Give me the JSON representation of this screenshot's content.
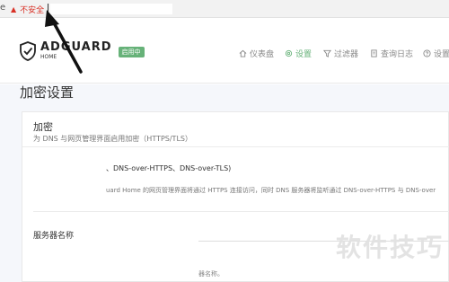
{
  "browser": {
    "security_warning": "不安全",
    "edge_glyph": "e"
  },
  "app": {
    "brand": "ADGUARD",
    "brand_sub": "HOME",
    "badge": "启用中",
    "nav": [
      {
        "label": "仪表盘",
        "icon": "home-icon"
      },
      {
        "label": "设置",
        "icon": "gear-icon",
        "active": true
      },
      {
        "label": "过滤器",
        "icon": "filter-icon"
      },
      {
        "label": "查询日志",
        "icon": "log-icon"
      },
      {
        "label": "设置",
        "icon": "help-icon"
      }
    ]
  },
  "page": {
    "title": "加密设置",
    "card": {
      "title": "加密",
      "subtitle": "为 DNS 与网页管理界面启用加密（HTTPS/TLS）",
      "protocols_text": "、DNS-over-HTTPS、DNS-over-TLS)",
      "description_text": "uard Home 的网页管理界面将通过 HTTPS 连接访问，同时 DNS 服务器将监听通过 DNS-over-HTTPS 与 DNS-over",
      "server_name_label": "服务器名称",
      "server_name_hint": "器名称。"
    }
  },
  "watermark": "软件技巧",
  "colors": {
    "accent": "#67b279",
    "warning": "#d93025",
    "page_bg": "#f5f7fb"
  }
}
